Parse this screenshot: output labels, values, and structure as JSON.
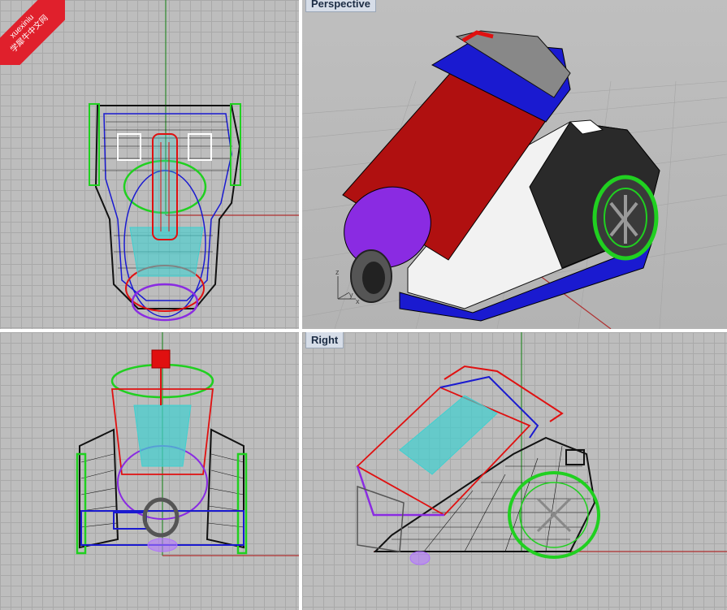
{
  "viewports": {
    "top": {
      "label": ""
    },
    "persp": {
      "label": "Perspective"
    },
    "front": {
      "label": ""
    },
    "right": {
      "label": "Right"
    }
  },
  "watermark": {
    "line1": "xuexiniu",
    "line2": "学犀牛中文网"
  },
  "axis_gizmo": {
    "z": "z",
    "y": "y",
    "x": "x"
  },
  "colors": {
    "grid_bg": "#bdbdbd",
    "grid_line": "#a9a9a9",
    "x_axis": "#b03030",
    "y_axis": "#2e8b2e",
    "red_part": "#e01010",
    "blue_part": "#1a1ad0",
    "green_part": "#20d020",
    "purple_part": "#8a2be2",
    "cyan_part": "#40d0d0",
    "black_wire": "#111111"
  }
}
